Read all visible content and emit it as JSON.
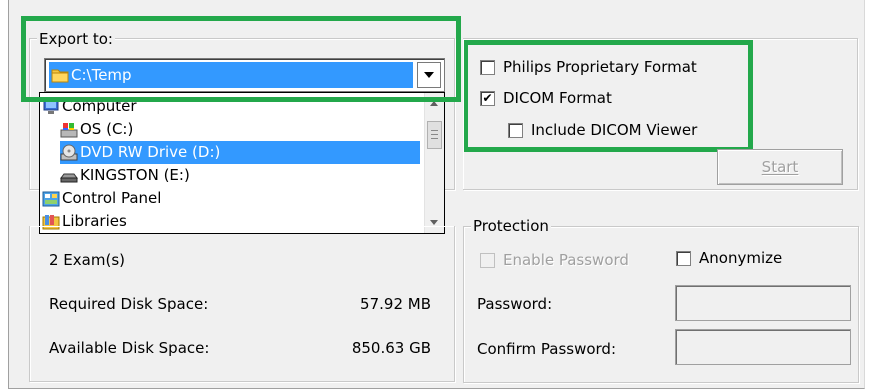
{
  "export_to": {
    "legend": "Export to:",
    "combo": {
      "value": "C:\\Temp",
      "icon": "folder-icon"
    },
    "dropdown": {
      "items": [
        {
          "label": "Computer",
          "icon": "computer-icon",
          "selected": false
        },
        {
          "label": "OS (C:)",
          "icon": "hard-drive-icon",
          "selected": false
        },
        {
          "label": "DVD RW Drive (D:)",
          "icon": "dvd-drive-icon",
          "selected": true
        },
        {
          "label": "KINGSTON (E:)",
          "icon": "removable-drive-icon",
          "selected": false
        },
        {
          "label": "Control Panel",
          "icon": "control-panel-icon",
          "selected": false
        },
        {
          "label": "Libraries",
          "icon": "libraries-icon",
          "selected": false
        }
      ]
    }
  },
  "format": {
    "philips": {
      "label": "Philips Proprietary Format",
      "checked": false
    },
    "dicom": {
      "label": "DICOM Format",
      "checked": true
    },
    "include_viewer": {
      "label": "Include DICOM Viewer",
      "checked": false
    }
  },
  "start_button": {
    "label": "Start",
    "enabled": false
  },
  "summary": {
    "exams": "2 Exam(s)",
    "required_label": "Required Disk Space:",
    "required_value": "57.92 MB",
    "available_label": "Available Disk Space:",
    "available_value": "850.63 GB"
  },
  "protection": {
    "legend": "Protection",
    "enable_password": {
      "label": "Enable Password",
      "checked": false,
      "enabled": false
    },
    "anonymize": {
      "label": "Anonymize",
      "checked": false
    },
    "password_label": "Password:",
    "password_value": "",
    "confirm_label": "Confirm Password:",
    "confirm_value": ""
  },
  "colors": {
    "highlight_frame": "#23a84b",
    "selection": "#3399ff",
    "dialog_bg": "#f0f0f0"
  }
}
